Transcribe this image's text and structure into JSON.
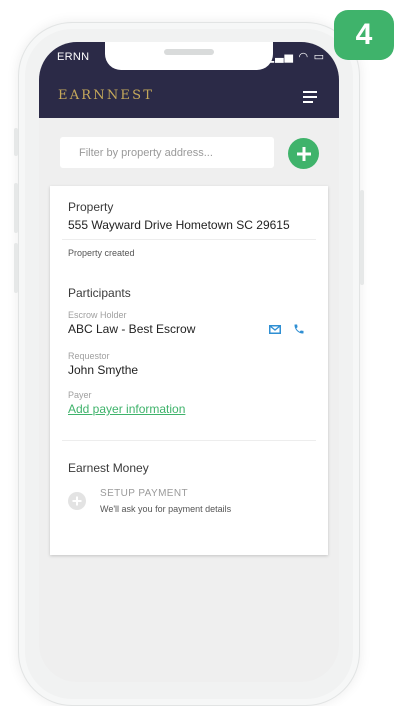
{
  "step_badge": "4",
  "status_bar": {
    "carrier": "ERNN",
    "icons": "▁▃▅ ◠ ▭"
  },
  "header": {
    "brand": "EARNNEST"
  },
  "filter": {
    "placeholder": "Filter by property address..."
  },
  "property": {
    "title": "Property",
    "address": "555 Wayward Drive Hometown SC 29615",
    "status": "Property created"
  },
  "participants": {
    "title": "Participants",
    "escrow_holder_label": "Escrow Holder",
    "escrow_holder_name": "ABC Law - Best Escrow",
    "requestor_label": "Requestor",
    "requestor_name": "John Smythe",
    "payer_label": "Payer",
    "payer_link": "Add payer information"
  },
  "earnest_money": {
    "title": "Earnest Money",
    "setup_title": "SETUP PAYMENT",
    "setup_desc": "We'll ask you for payment details"
  },
  "colors": {
    "navy": "#2b2a47",
    "brand_gold": "#c6a95b",
    "accent_green": "#3fb36b",
    "icon_blue": "#2f8fd3"
  }
}
